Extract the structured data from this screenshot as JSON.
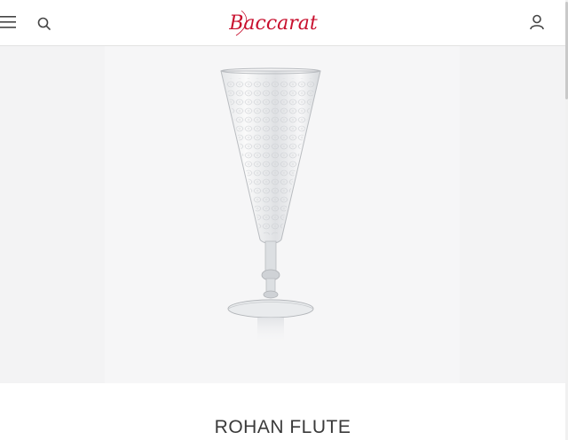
{
  "header": {
    "brand": "Baccarat",
    "menu_icon": "hamburger-menu-icon",
    "search_icon": "search-icon",
    "account_icon": "user-account-icon",
    "brand_color": "#c8102e"
  },
  "product": {
    "title": "ROHAN FLUTE",
    "image_alt": "Rohan flute glass"
  }
}
